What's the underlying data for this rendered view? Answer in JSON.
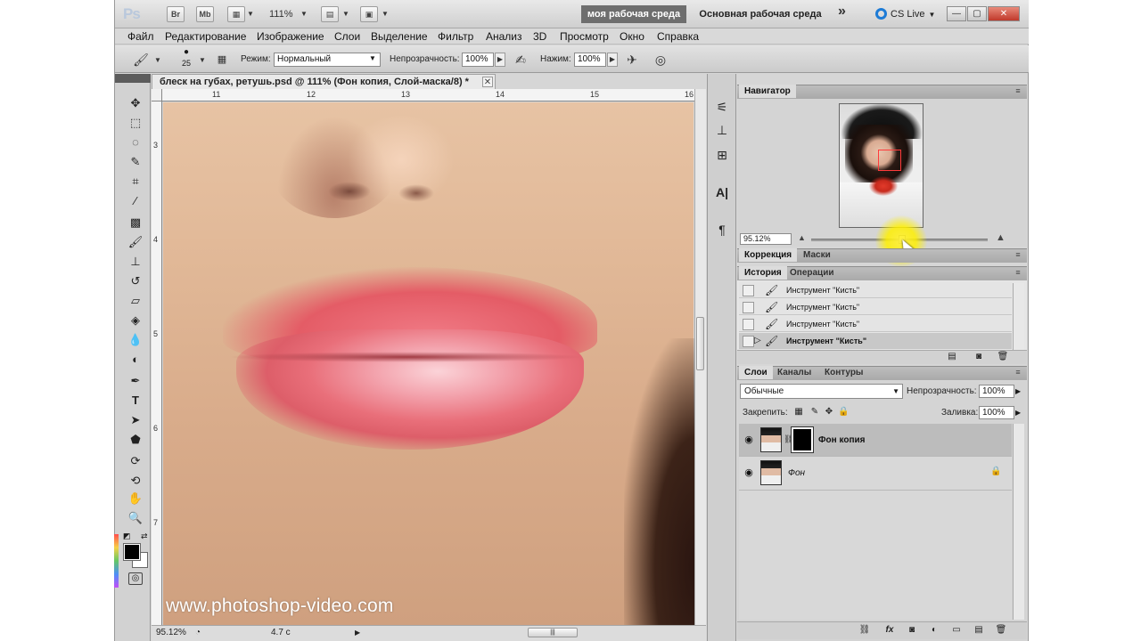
{
  "appbar": {
    "logo": "Ps",
    "bridge": "Br",
    "minibridge": "Mb",
    "zoom": "111%",
    "workspace_active": "моя рабочая среда",
    "workspace_main": "Основная рабочая среда",
    "more": "»",
    "cslive": "CS Live",
    "min": "—",
    "max": "▢",
    "close": "✕"
  },
  "menu": [
    "Файл",
    "Редактирование",
    "Изображение",
    "Слои",
    "Выделение",
    "Фильтр",
    "Анализ",
    "3D",
    "Просмотр",
    "Окно",
    "Справка"
  ],
  "options": {
    "brush_size": "25",
    "mode_label": "Режим:",
    "mode_value": "Нормальный",
    "opacity_label": "Непрозрачность:",
    "opacity_value": "100%",
    "flow_label": "Нажим:",
    "flow_value": "100%"
  },
  "document": {
    "tab_title": "блеск на губах, ретушь.psd @ 111% (Фон копия, Слой-маска/8) *",
    "close": "✕",
    "ruler_h": [
      "11",
      "12",
      "13",
      "14",
      "15",
      "16"
    ],
    "ruler_v": [
      "3",
      "4",
      "5",
      "6",
      "7"
    ],
    "watermark": "www.photoshop-video.com",
    "status_zoom": "95.12%",
    "status_time": "4.7 с"
  },
  "navigator": {
    "tab": "Навигатор",
    "zoom": "95.12%"
  },
  "correction": {
    "tabs": [
      "Коррекция",
      "Маски"
    ]
  },
  "history": {
    "tabs": [
      "История",
      "Операции"
    ],
    "items": [
      "Инструмент \"Кисть\"",
      "Инструмент \"Кисть\"",
      "Инструмент \"Кисть\"",
      "Инструмент \"Кисть\""
    ]
  },
  "layers": {
    "tabs": [
      "Слои",
      "Каналы",
      "Контуры"
    ],
    "blend": "Обычные",
    "opacity_label": "Непрозрачность:",
    "opacity_value": "100%",
    "lock_label": "Закрепить:",
    "fill_label": "Заливка:",
    "fill_value": "100%",
    "items": [
      {
        "name": "Фон копия",
        "selected": true
      },
      {
        "name": "Фон",
        "selected": false
      }
    ]
  },
  "icons": {
    "tools": [
      "move-icon",
      "marquee-icon",
      "lasso-icon",
      "quick-select-icon",
      "crop-icon",
      "eyedropper-icon",
      "healing-icon",
      "brush-icon",
      "clone-stamp-icon",
      "history-brush-icon",
      "eraser-icon",
      "gradient-icon",
      "blur-icon",
      "dodge-icon",
      "pen-icon",
      "type-icon",
      "path-select-icon",
      "shape-icon",
      "3d-rotate-icon",
      "3d-camera-icon",
      "hand-icon",
      "zoom-icon"
    ]
  }
}
